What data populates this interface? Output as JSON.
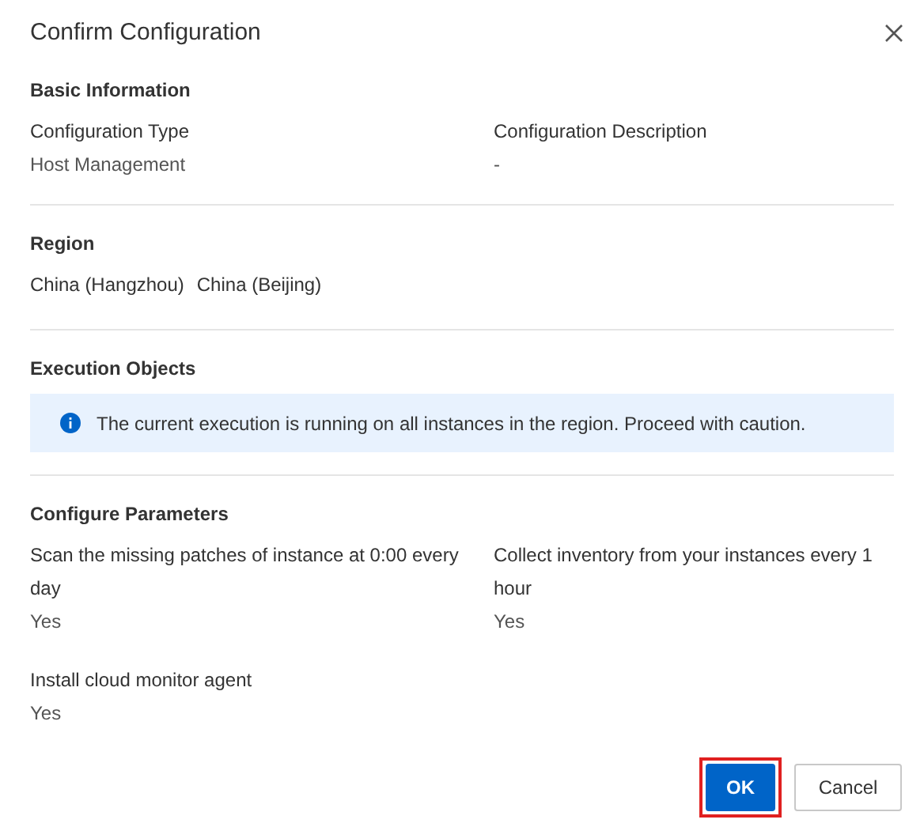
{
  "dialog": {
    "title": "Confirm Configuration"
  },
  "sections": [
    {
      "kind": "fields",
      "heading": "Basic Information",
      "fields": [
        {
          "label": "Configuration Type",
          "value": "Host Management"
        },
        {
          "label": "Configuration Description",
          "value": "-"
        }
      ]
    },
    {
      "kind": "tags",
      "heading": "Region",
      "values": [
        "China (Hangzhou)",
        "China (Beijing)"
      ]
    },
    {
      "kind": "notice",
      "heading": "Execution Objects",
      "notice": "The current execution is running on all instances in the region. Proceed with caution."
    },
    {
      "kind": "fields",
      "heading": "Configure Parameters",
      "fields": [
        {
          "label": "Scan the missing patches of instance at 0:00 every day",
          "value": "Yes"
        },
        {
          "label": "Collect inventory from your instances every 1 hour",
          "value": "Yes"
        },
        {
          "label": "Install cloud monitor agent",
          "value": "Yes"
        }
      ]
    }
  ],
  "buttons": [
    {
      "label": "OK",
      "kind": "primary",
      "highlighted": true
    },
    {
      "label": "Cancel",
      "kind": "secondary",
      "highlighted": false
    }
  ]
}
